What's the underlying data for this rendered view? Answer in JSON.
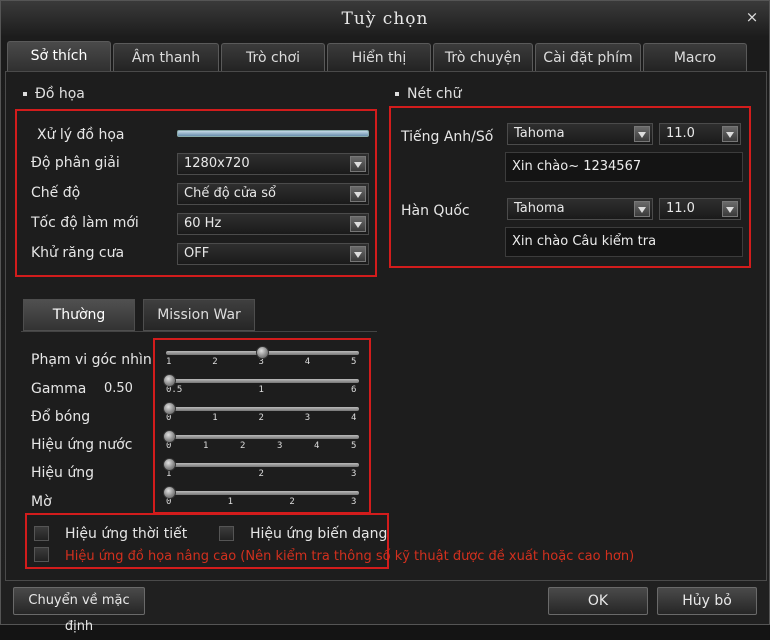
{
  "window": {
    "title": "Tuỳ chọn",
    "close": "×"
  },
  "tabs": [
    {
      "label": "Sở thích"
    },
    {
      "label": "Âm thanh"
    },
    {
      "label": "Trò chơi"
    },
    {
      "label": "Hiển thị"
    },
    {
      "label": "Trò chuyện"
    },
    {
      "label": "Cài đặt phím"
    },
    {
      "label": "Macro"
    }
  ],
  "graphics": {
    "section_title": "Đồ họa",
    "processing_label": "Xử lý đồ họa",
    "processing_level": 1.0,
    "resolution": {
      "label": "Độ phân giải",
      "value": "1280x720"
    },
    "mode": {
      "label": "Chế độ",
      "value": "Chế độ cửa sổ"
    },
    "refresh": {
      "label": "Tốc độ làm mới",
      "value": "60 Hz"
    },
    "antialias": {
      "label": "Khử răng cưa",
      "value": "OFF"
    }
  },
  "font": {
    "section_title": "Nét chữ",
    "english": {
      "label": "Tiếng Anh/Số",
      "font": "Tahoma",
      "size": "11.0",
      "preview": "Xin chào~ 1234567"
    },
    "korean": {
      "label": "Hàn Quốc",
      "font": "Tahoma",
      "size": "11.0",
      "preview": "Xin chào Câu kiểm tra"
    }
  },
  "subtabs": [
    {
      "label": "Thường"
    },
    {
      "label": "Mission War"
    }
  ],
  "sliders": [
    {
      "label": "Phạm vi góc nhìn",
      "ticks": [
        "1",
        "2",
        "3",
        "4",
        "5"
      ],
      "value": 3
    },
    {
      "label": "Gamma",
      "readout": "0.50",
      "ticks": [
        "0.5",
        "1",
        "6"
      ],
      "value": 0.5
    },
    {
      "label": "Đổ bóng",
      "ticks": [
        "0",
        "1",
        "2",
        "3",
        "4"
      ],
      "value": 0
    },
    {
      "label": "Hiệu ứng nước",
      "ticks": [
        "0",
        "1",
        "2",
        "3",
        "4",
        "5"
      ],
      "value": 0
    },
    {
      "label": "Hiệu ứng",
      "ticks": [
        "1",
        "2",
        "3"
      ],
      "value": 1
    },
    {
      "label": "Mờ",
      "ticks": [
        "0",
        "1",
        "2",
        "3"
      ],
      "value": 0
    }
  ],
  "checks": {
    "weather": {
      "label": "Hiệu ứng thời tiết",
      "checked": false
    },
    "distortion": {
      "label": "Hiệu ứng biến dạng",
      "checked": false
    },
    "advanced": {
      "label": "Hiệu ứng đồ họa nâng cao (Nên kiểm tra thông số kỹ thuật được đề xuất hoặc cao hơn)",
      "checked": false
    }
  },
  "buttons": {
    "reset": "Chuyển về mặc định",
    "ok": "OK",
    "cancel": "Hủy bỏ"
  },
  "colors": {
    "highlight": "#d21c1c",
    "warning": "#d2301e"
  }
}
